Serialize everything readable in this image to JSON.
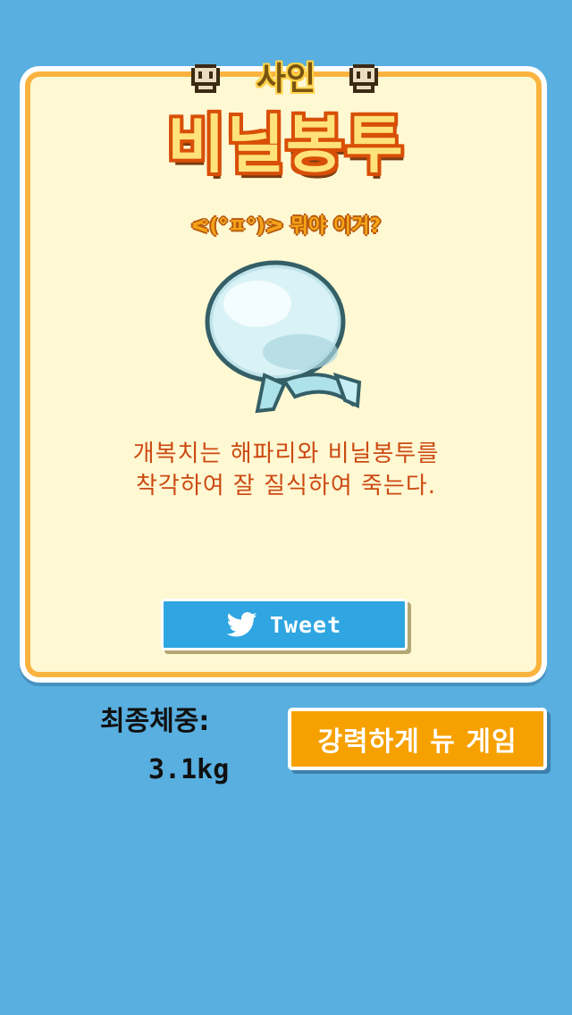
{
  "result": {
    "cause_label": "사인",
    "death_title": "비닐봉투",
    "subtitle": "ᕙ(°ㅍ°)ᕗ 뭐야 이거?",
    "description_lines": [
      "개복치는 해파리와 비닐봉투를",
      "착각하여 잘 질식하여 죽는다."
    ],
    "illustration": "plastic-bag-icon"
  },
  "share": {
    "tweet_label": "Tweet",
    "icon": "twitter-bird-icon"
  },
  "stats": {
    "final_weight_label": "최종체중:",
    "final_weight_value": "3.1kg"
  },
  "actions": {
    "new_game_label": "강력하게 뉴 게임"
  },
  "colors": {
    "background": "#58afe0",
    "card_fill": "#fef8d3",
    "card_border": "#fbb33f",
    "title_fill": "#ffe27a",
    "title_outline": "#d84f07",
    "description_text": "#cc4a12",
    "tweet_button": "#2fa6e1",
    "new_game_button": "#f6a100"
  }
}
